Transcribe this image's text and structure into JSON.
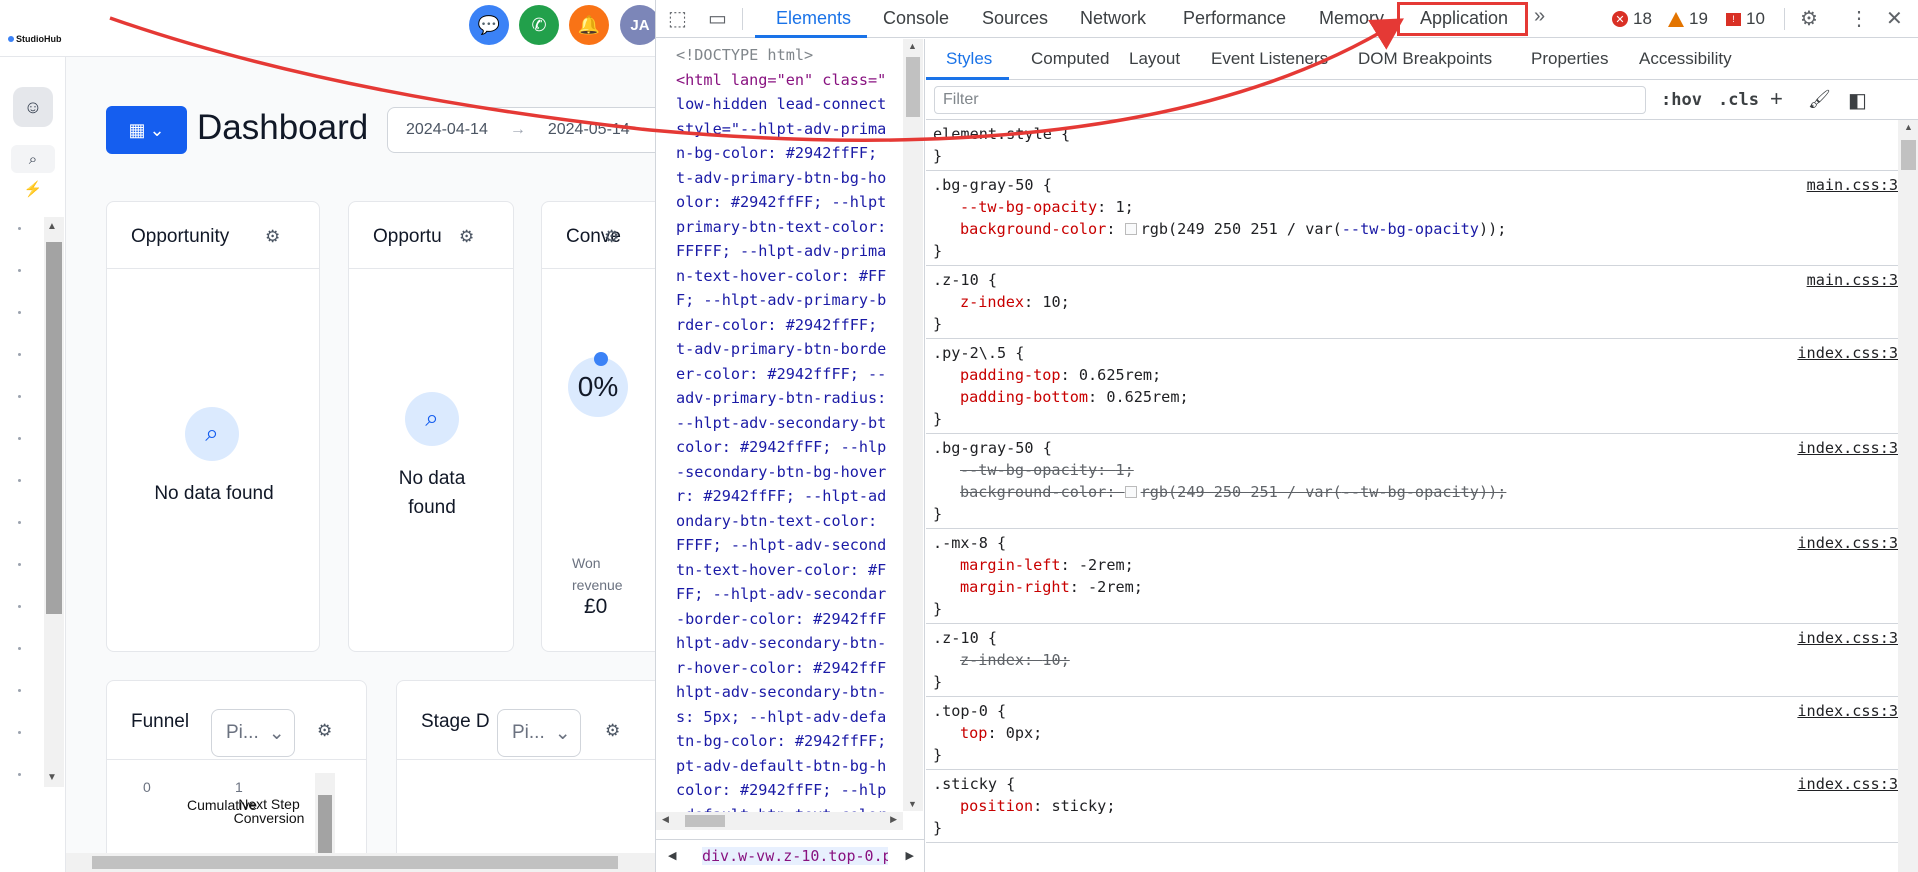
{
  "app": {
    "brand": "StudioHub",
    "topbar": {
      "avatar_initials": "JA"
    },
    "dashboard": {
      "title": "Dashboard",
      "date_start": "2024-04-14",
      "date_arrow": "→",
      "date_end": "2024-05-14"
    },
    "cards": [
      {
        "title": "Opportunity",
        "empty_text": "No data found"
      },
      {
        "title": "Opportu",
        "empty_text_1": "No data",
        "empty_text_2": "found"
      },
      {
        "title": "Conve",
        "percent": "0%",
        "won_label": "Won revenue",
        "won_value": "£0"
      }
    ],
    "funnel": {
      "title": "Funnel",
      "select": "Pi...",
      "axis_0": "0",
      "axis_1": "1",
      "col_1": "Cumulative",
      "col_2": "Next Step Conversion"
    },
    "stage": {
      "title": "Stage D",
      "select": "Pi..."
    }
  },
  "devtools": {
    "tabs": [
      "Elements",
      "Console",
      "Sources",
      "Network",
      "Performance",
      "Memory",
      "Application"
    ],
    "active_tab": "Elements",
    "highlighted_tab": "Application",
    "errors": "18",
    "warnings": "19",
    "issues": "10",
    "elements_code": [
      "<!DOCTYPE html>",
      "<html lang=\"en\" class=\"",
      "low-hidden lead-connect",
      "style=\"--hlpt-adv-prima",
      "n-bg-color: #2942ffFF;",
      "t-adv-primary-btn-bg-ho",
      "olor: #2942ffFF; --hlpt",
      "primary-btn-text-color:",
      "FFFFF; --hlpt-adv-prima",
      "n-text-hover-color: #FF",
      "F; --hlpt-adv-primary-b",
      "rder-color: #2942ffFF;",
      "t-adv-primary-btn-borde",
      "er-color: #2942ffFF; --",
      "adv-primary-btn-radius:",
      "--hlpt-adv-secondary-bt",
      "color: #2942ffFF; --hlp",
      "-secondary-btn-bg-hover",
      "r: #2942ffFF; --hlpt-ad",
      "ondary-btn-text-color:",
      "FFFF; --hlpt-adv-second",
      "tn-text-hover-color: #F",
      "FF; --hlpt-adv-secondar",
      "-border-color: #2942ffF",
      "hlpt-adv-secondary-btn-",
      "r-hover-color: #2942ffF",
      "hlpt-adv-secondary-btn-",
      "s: 5px; --hlpt-adv-defa",
      "tn-bg-color: #2942ffFF;",
      "pt-adv-default-btn-bg-h",
      "color: #2942ffFF; --hlp",
      "-default-btn-text-color"
    ],
    "breadcrumb": "div.w-vw.z-10.top-0.py-",
    "styles_tabs": [
      "Styles",
      "Computed",
      "Layout",
      "Event Listeners",
      "DOM Breakpoints",
      "Properties",
      "Accessibility"
    ],
    "filter_placeholder": "Filter",
    "hov": ":hov",
    "cls": ".cls",
    "element_style": "element.style {",
    "rules": [
      {
        "selector": ".bg-gray-50 {",
        "source": "main.css:3",
        "decls": [
          {
            "p": "--tw-bg-opacity",
            "v": "1;"
          },
          {
            "p": "background-color",
            "v": "rgb(249 250 251 / var(",
            "var": "--tw-bg-opacity",
            "tail": "));",
            "swatch": true
          }
        ]
      },
      {
        "selector": ".z-10 {",
        "source": "main.css:3",
        "decls": [
          {
            "p": "z-index",
            "v": "10;"
          }
        ]
      },
      {
        "selector": ".py-2\\.5 {",
        "source": "index.css:3",
        "decls": [
          {
            "p": "padding-top",
            "v": "0.625rem;"
          },
          {
            "p": "padding-bottom",
            "v": "0.625rem;"
          }
        ]
      },
      {
        "selector": ".bg-gray-50 {",
        "source": "index.css:3",
        "decls": [
          {
            "p": "--tw-bg-opacity",
            "v": "1;",
            "strike": true
          },
          {
            "p": "background-color",
            "v": "rgb(249 250 251 / var(",
            "var": "--tw-bg-opacity",
            "tail": "));",
            "swatch": true,
            "strike": true
          }
        ]
      },
      {
        "selector": ".-mx-8 {",
        "source": "index.css:3",
        "decls": [
          {
            "p": "margin-left",
            "v": "-2rem;"
          },
          {
            "p": "margin-right",
            "v": "-2rem;"
          }
        ]
      },
      {
        "selector": ".z-10 {",
        "source": "index.css:3",
        "decls": [
          {
            "p": "z-index",
            "v": "10;",
            "strike": true
          }
        ]
      },
      {
        "selector": ".top-0 {",
        "source": "index.css:3",
        "decls": [
          {
            "p": "top",
            "v": "0px;"
          }
        ]
      },
      {
        "selector": ".sticky {",
        "source": "index.css:3",
        "decls": [
          {
            "p": "position",
            "v": "sticky;"
          }
        ]
      }
    ],
    "close_brace": "}"
  },
  "colors": {
    "accent": "#1a73e8",
    "brand_blue": "#155eef",
    "annotation_red": "#e53935"
  }
}
